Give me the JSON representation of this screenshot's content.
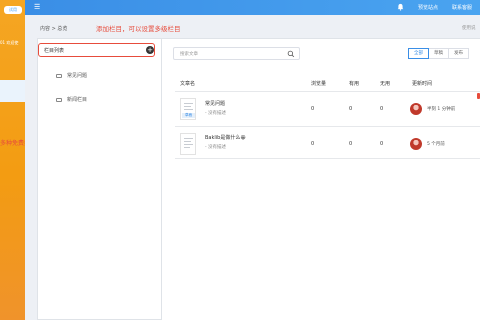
{
  "strip": {
    "badge": "试用",
    "side_text": "01 欢迎使",
    "promo": "多种免费插件"
  },
  "topbar": {
    "menu_glyph": "☰",
    "link_site": "预览站点",
    "link_service": "联系客服"
  },
  "breadcrumb": {
    "path": "内容 > 总览",
    "help": "使用说"
  },
  "annotation": {
    "add_column_hint": "添加栏目，可以设置多级栏目"
  },
  "columns": {
    "header": "栏目列表",
    "add_glyph": "+",
    "items": [
      {
        "label": "常见问题"
      },
      {
        "label": "新闻栏目"
      }
    ]
  },
  "search": {
    "placeholder": "搜索文章"
  },
  "filters": [
    {
      "label": "全部",
      "active": true
    },
    {
      "label": "草稿",
      "active": false
    },
    {
      "label": "发布",
      "active": false
    }
  ],
  "table": {
    "headers": {
      "name": "文章名",
      "views": "浏览量",
      "useful": "有用",
      "useless": "无用",
      "updated": "更新时间"
    },
    "rows": [
      {
        "title": "常见问题",
        "desc": "- 没有描述",
        "thumb_tag": "草稿",
        "views": "0",
        "useful": "0",
        "useless": "0",
        "updated": "半刻 1 分钟前"
      },
      {
        "title": "Baklib是做什么😀",
        "desc": "- 没有描述",
        "thumb_tag": "",
        "views": "0",
        "useful": "0",
        "useless": "0",
        "updated": "5 个月前"
      }
    ]
  },
  "colors": {
    "accent_blue": "#3a8ee6",
    "strip_orange": "#f5a623",
    "annotation_red": "#e74c3c"
  },
  "icons": {
    "menu": "menu-icon",
    "bell": "bell-icon",
    "search": "search-icon",
    "add": "add-circle-icon",
    "folder": "folder-icon",
    "avatar": "avatar"
  }
}
